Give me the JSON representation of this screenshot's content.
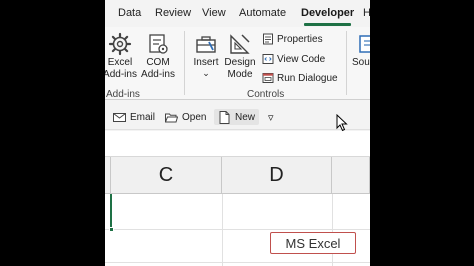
{
  "tabs": {
    "data": "Data",
    "review": "Review",
    "view": "View",
    "automate": "Automate",
    "developer": "Developer",
    "next": "H"
  },
  "ribbon": {
    "excel_addins": [
      "Excel",
      "Add-ins"
    ],
    "com_addins": [
      "COM",
      "Add-ins"
    ],
    "addins_group_label": "Add-ins",
    "insert_label": "Insert",
    "insert_caret": "⌄",
    "design_mode": [
      "Design",
      "Mode"
    ],
    "properties": "Properties",
    "view_code": "View Code",
    "run_dialogue": "Run Dialogue",
    "controls_group_label": "Controls",
    "source_partial": "Sou"
  },
  "quickbar": {
    "email": "Email",
    "open": "Open",
    "new": "New",
    "more": "▿"
  },
  "columns": [
    "C",
    "D"
  ],
  "overlay_label": "MS Excel",
  "colors": {
    "accent": "#1e7145",
    "overlay_border": "#c0504d"
  }
}
